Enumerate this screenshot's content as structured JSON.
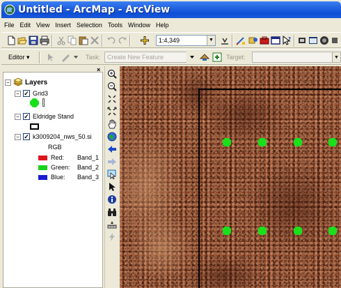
{
  "window": {
    "title": "Untitled - ArcMap - ArcView"
  },
  "menu": {
    "items": [
      "File",
      "Edit",
      "View",
      "Insert",
      "Selection",
      "Tools",
      "Window",
      "Help"
    ]
  },
  "standard_toolbar": {
    "scale_value": "1:4,349",
    "buttons": [
      "new-document",
      "open",
      "save",
      "print",
      "cut",
      "copy",
      "paste",
      "delete",
      "undo",
      "redo",
      "add-data",
      "editor-toolbar",
      "arc-toolbox",
      "identify-results",
      "what-is-this",
      "arc-catalog",
      "arc-toolbox-2",
      "model-builder"
    ]
  },
  "editor_toolbar": {
    "editor_label": "Editor ▾",
    "task_label": "Task:",
    "task_value": "Create New Feature",
    "target_label": "Target:",
    "target_value": ""
  },
  "toc": {
    "close_label": "×",
    "root_label": "Layers",
    "layers": [
      {
        "name": "Grid3",
        "checked": true,
        "symbol": "green-octagon"
      },
      {
        "name": "Eldridge Stand",
        "checked": true,
        "symbol": "hollow-rectangle"
      },
      {
        "name": "k3009204_nws_50.si",
        "checked": true,
        "symbol": "raster",
        "renderer": "RGB",
        "bands": [
          {
            "channel": "Red:",
            "band": "Band_1",
            "color": "#e0141e"
          },
          {
            "channel": "Green:",
            "band": "Band_2",
            "color": "#1ad21a"
          },
          {
            "channel": "Blue:",
            "band": "Band_3",
            "color": "#1a1ad2"
          }
        ]
      }
    ]
  },
  "tools": [
    "zoom-in",
    "zoom-out",
    "fixed-zoom-in",
    "fixed-zoom-out",
    "pan",
    "full-extent",
    "back-extent",
    "forward-extent",
    "select-features",
    "select-elements",
    "identify",
    "find",
    "measure",
    "hyperlink"
  ],
  "map": {
    "point_color": "#19e01a",
    "outline_color": "#000000"
  }
}
